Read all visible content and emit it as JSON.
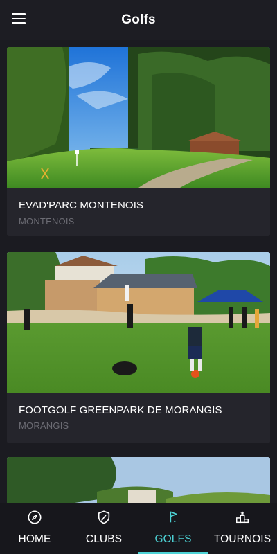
{
  "app_bar": {
    "title": "Golfs",
    "menu_icon": "hamburger-menu-icon"
  },
  "golfs": [
    {
      "name": "EVAD'PARC MONTENOIS",
      "city": "MONTENOIS"
    },
    {
      "name": "FOOTGOLF GREENPARK DE MORANGIS",
      "city": "MORANGIS"
    },
    {
      "name": "",
      "city": ""
    }
  ],
  "bottom_nav": {
    "active_tab": "GOLFS",
    "accent_color": "#4dd3d6",
    "tabs": [
      {
        "label": "HOME",
        "icon": "compass-icon"
      },
      {
        "label": "CLUBS",
        "icon": "shield-icon"
      },
      {
        "label": "GOLFS",
        "icon": "flag-icon"
      },
      {
        "label": "TOURNOIS",
        "icon": "podium-icon"
      }
    ]
  }
}
